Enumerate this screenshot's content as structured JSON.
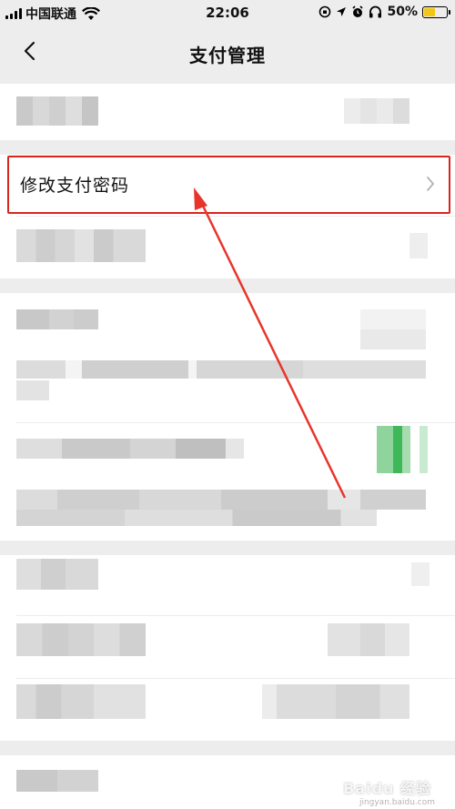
{
  "status_bar": {
    "carrier": "中国联通",
    "time": "22:06",
    "battery_percent": "50%",
    "battery_level": 0.5,
    "icons": [
      "signal-icon",
      "wifi-icon",
      "rotation-lock-icon",
      "location-icon",
      "alarm-icon",
      "headphones-icon",
      "battery-icon"
    ]
  },
  "nav": {
    "title": "支付管理",
    "back_icon": "chevron-left-icon"
  },
  "menu": {
    "highlighted_item": {
      "label": "修改支付密码",
      "icon": "chevron-right-icon"
    },
    "blurred_items_count_note": ""
  },
  "annotation": {
    "box_color": "#d9251d",
    "arrow_color": "#e8352b"
  },
  "watermark": {
    "text": "Baidu 经验",
    "sub": "jingyan.baidu.com"
  }
}
